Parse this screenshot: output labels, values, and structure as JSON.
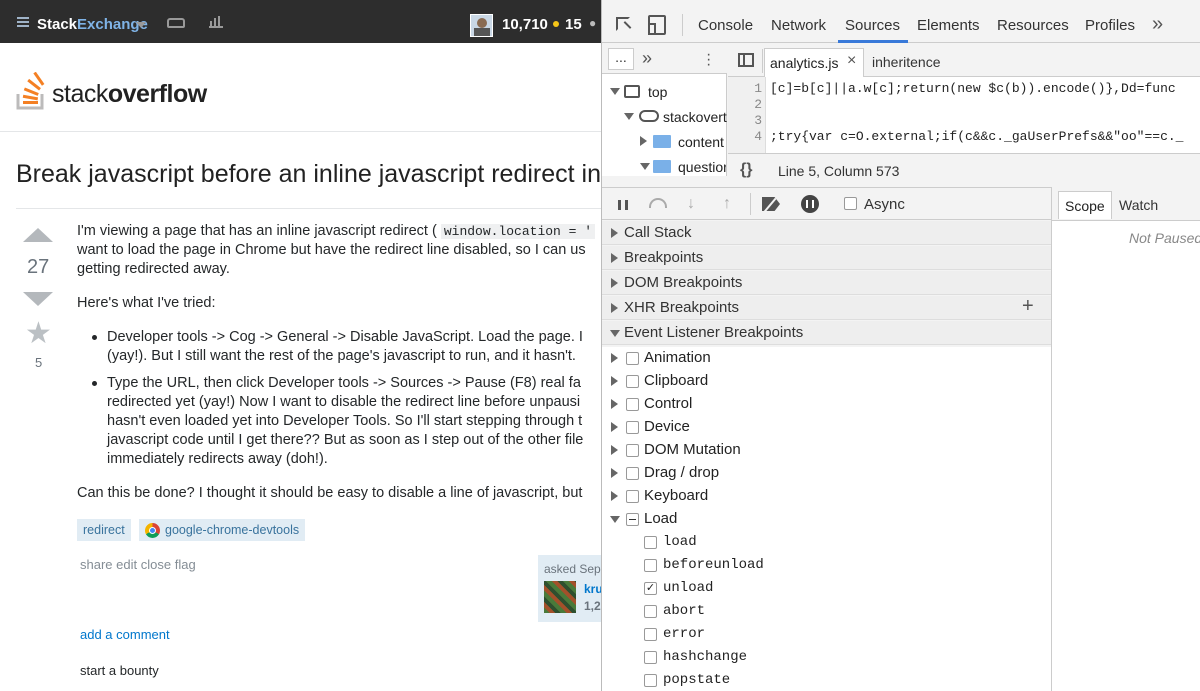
{
  "topbar": {
    "brand_a": "Stack",
    "brand_b": "Exchange",
    "reputation": "10,710",
    "badge_count": "15",
    "badge_more": "●"
  },
  "so": {
    "logo_a": "stack",
    "logo_b": "overflow"
  },
  "question": {
    "title": "Break javascript before an inline javascript redirect in C",
    "votes": "27",
    "favs": "5",
    "p1a": "I'm viewing a page that has an inline javascript redirect (",
    "p1code": "window.location = '",
    "p1b": "want to load the page in Chrome but have the redirect line disabled, so I can us",
    "p1c": "getting redirected away.",
    "p2": "Here's what I've tried:",
    "b1a": "Developer tools -> Cog -> General -> Disable JavaScript. Load the page. I",
    "b1b": "(yay!). But I still want the rest of the page's javascript to run, and it hasn't.",
    "b2a": "Type the URL, then click Developer tools -> Sources -> Pause (F8) real fa",
    "b2b": "redirected yet (yay!) Now I want to disable the redirect line before unpausi",
    "b2c": "hasn't even loaded yet into Developer Tools. So I'll start stepping through t",
    "b2d": "javascript code until I get there?? But as soon as I step out of the other file",
    "b2e": "immediately redirects away (doh!).",
    "p3": "Can this be done? I thought it should be easy to disable a line of javascript, but",
    "tags": [
      "redirect",
      "google-chrome-devtools"
    ],
    "actions": [
      "share",
      "edit",
      "close",
      "flag"
    ],
    "asked": "asked Sep",
    "user_name": "kru",
    "user_rep": "1,2",
    "add_comment": "add a comment",
    "bounty": "start a bounty"
  },
  "devtools": {
    "tabs": [
      "Console",
      "Network",
      "Sources",
      "Elements",
      "Resources",
      "Profiles"
    ],
    "more": "»",
    "nav_dots": "...",
    "nav_more": "»",
    "tree": [
      {
        "label": "top"
      },
      {
        "label": "stackovert"
      },
      {
        "label": "content"
      },
      {
        "label": "questior"
      }
    ],
    "files": [
      {
        "label": "analytics.js"
      },
      {
        "label": "inheritence"
      }
    ],
    "close_x": "×",
    "code_lines": [
      {
        "n": "1",
        "text": "[c]=b[c]||a.w[c];return(new $c(b)).encode()},Dd=func"
      },
      {
        "n": "2",
        "text": ""
      },
      {
        "n": "3",
        "text": ""
      },
      {
        "n": "4",
        "text": ";try{var c=O.external;if(c&&c._gaUserPrefs&&\"oo\"==c._"
      }
    ],
    "status": "Line 5, Column 573",
    "braces": "{}",
    "async": "Async",
    "sections": [
      "Call Stack",
      "Breakpoints",
      "DOM Breakpoints",
      "XHR Breakpoints",
      "Event Listener Breakpoints"
    ],
    "plus": "+",
    "events": [
      "Animation",
      "Clipboard",
      "Control",
      "Device",
      "DOM Mutation",
      "Drag / drop",
      "Keyboard",
      "Load"
    ],
    "load_events": [
      {
        "label": "load",
        "checked": false
      },
      {
        "label": "beforeunload",
        "checked": false
      },
      {
        "label": "unload",
        "checked": true
      },
      {
        "label": "abort",
        "checked": false
      },
      {
        "label": "error",
        "checked": false
      },
      {
        "label": "hashchange",
        "checked": false
      },
      {
        "label": "popstate",
        "checked": false
      }
    ],
    "right_tabs": [
      "Scope",
      "Watch"
    ],
    "not_paused": "Not Paused"
  }
}
